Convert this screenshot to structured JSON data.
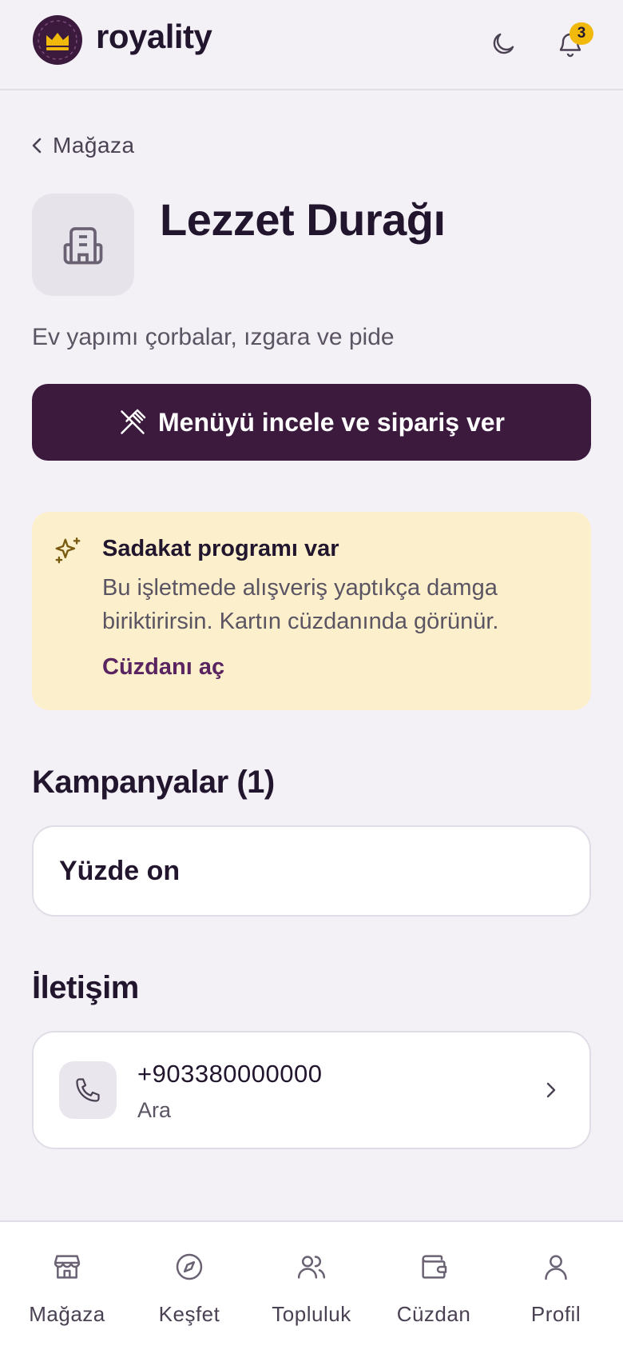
{
  "header": {
    "brand": "royality",
    "notification_count": "3"
  },
  "nav_back": {
    "label": "Mağaza"
  },
  "shop": {
    "name": "Lezzet Durağı",
    "description": "Ev yapımı çorbalar, ızgara ve pide",
    "menu_button_label": "Menüyü incele ve sipariş ver"
  },
  "loyalty": {
    "title": "Sadakat programı var",
    "text": "Bu işletmede alışveriş yaptıkça damga biriktirirsin. Kartın cüzdanında görünür.",
    "link_label": "Cüzdanı aç"
  },
  "campaigns": {
    "title": "Kampanyalar (1)",
    "items": [
      {
        "name": "Yüzde on"
      }
    ]
  },
  "contact": {
    "title": "İletişim",
    "phone": "+903380000000",
    "action_label": "Ara"
  },
  "bottom_nav": {
    "items": [
      {
        "label": "Mağaza",
        "icon": "store-icon"
      },
      {
        "label": "Keşfet",
        "icon": "compass-icon"
      },
      {
        "label": "Topluluk",
        "icon": "users-icon"
      },
      {
        "label": "Cüzdan",
        "icon": "wallet-icon"
      },
      {
        "label": "Profil",
        "icon": "user-icon"
      }
    ]
  },
  "colors": {
    "primary": "#3b1a3d",
    "background": "#f3f1f6",
    "accent_yellow": "#f2b90d",
    "loyalty_bg": "#fcf0cc"
  }
}
